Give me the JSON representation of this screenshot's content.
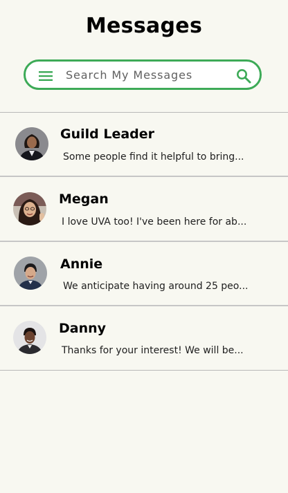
{
  "header": {
    "title": "Messages"
  },
  "search": {
    "placeholder": "Search My Messages",
    "value": ""
  },
  "icons": {
    "menu": "hamburger-menu-icon",
    "search": "magnifier-search-icon"
  },
  "colors": {
    "accent": "#3daa57",
    "background": "#f8f8f1",
    "divider": "#b8b8b8"
  },
  "conversations": [
    {
      "name": "Guild Leader",
      "preview": "Some people find it helpful to bring..."
    },
    {
      "name": "Megan",
      "preview": "I love UVA too! I've been here for ab..."
    },
    {
      "name": "Annie",
      "preview": "We anticipate having around 25 peo..."
    },
    {
      "name": "Danny",
      "preview": "Thanks for your interest! We will be..."
    }
  ]
}
